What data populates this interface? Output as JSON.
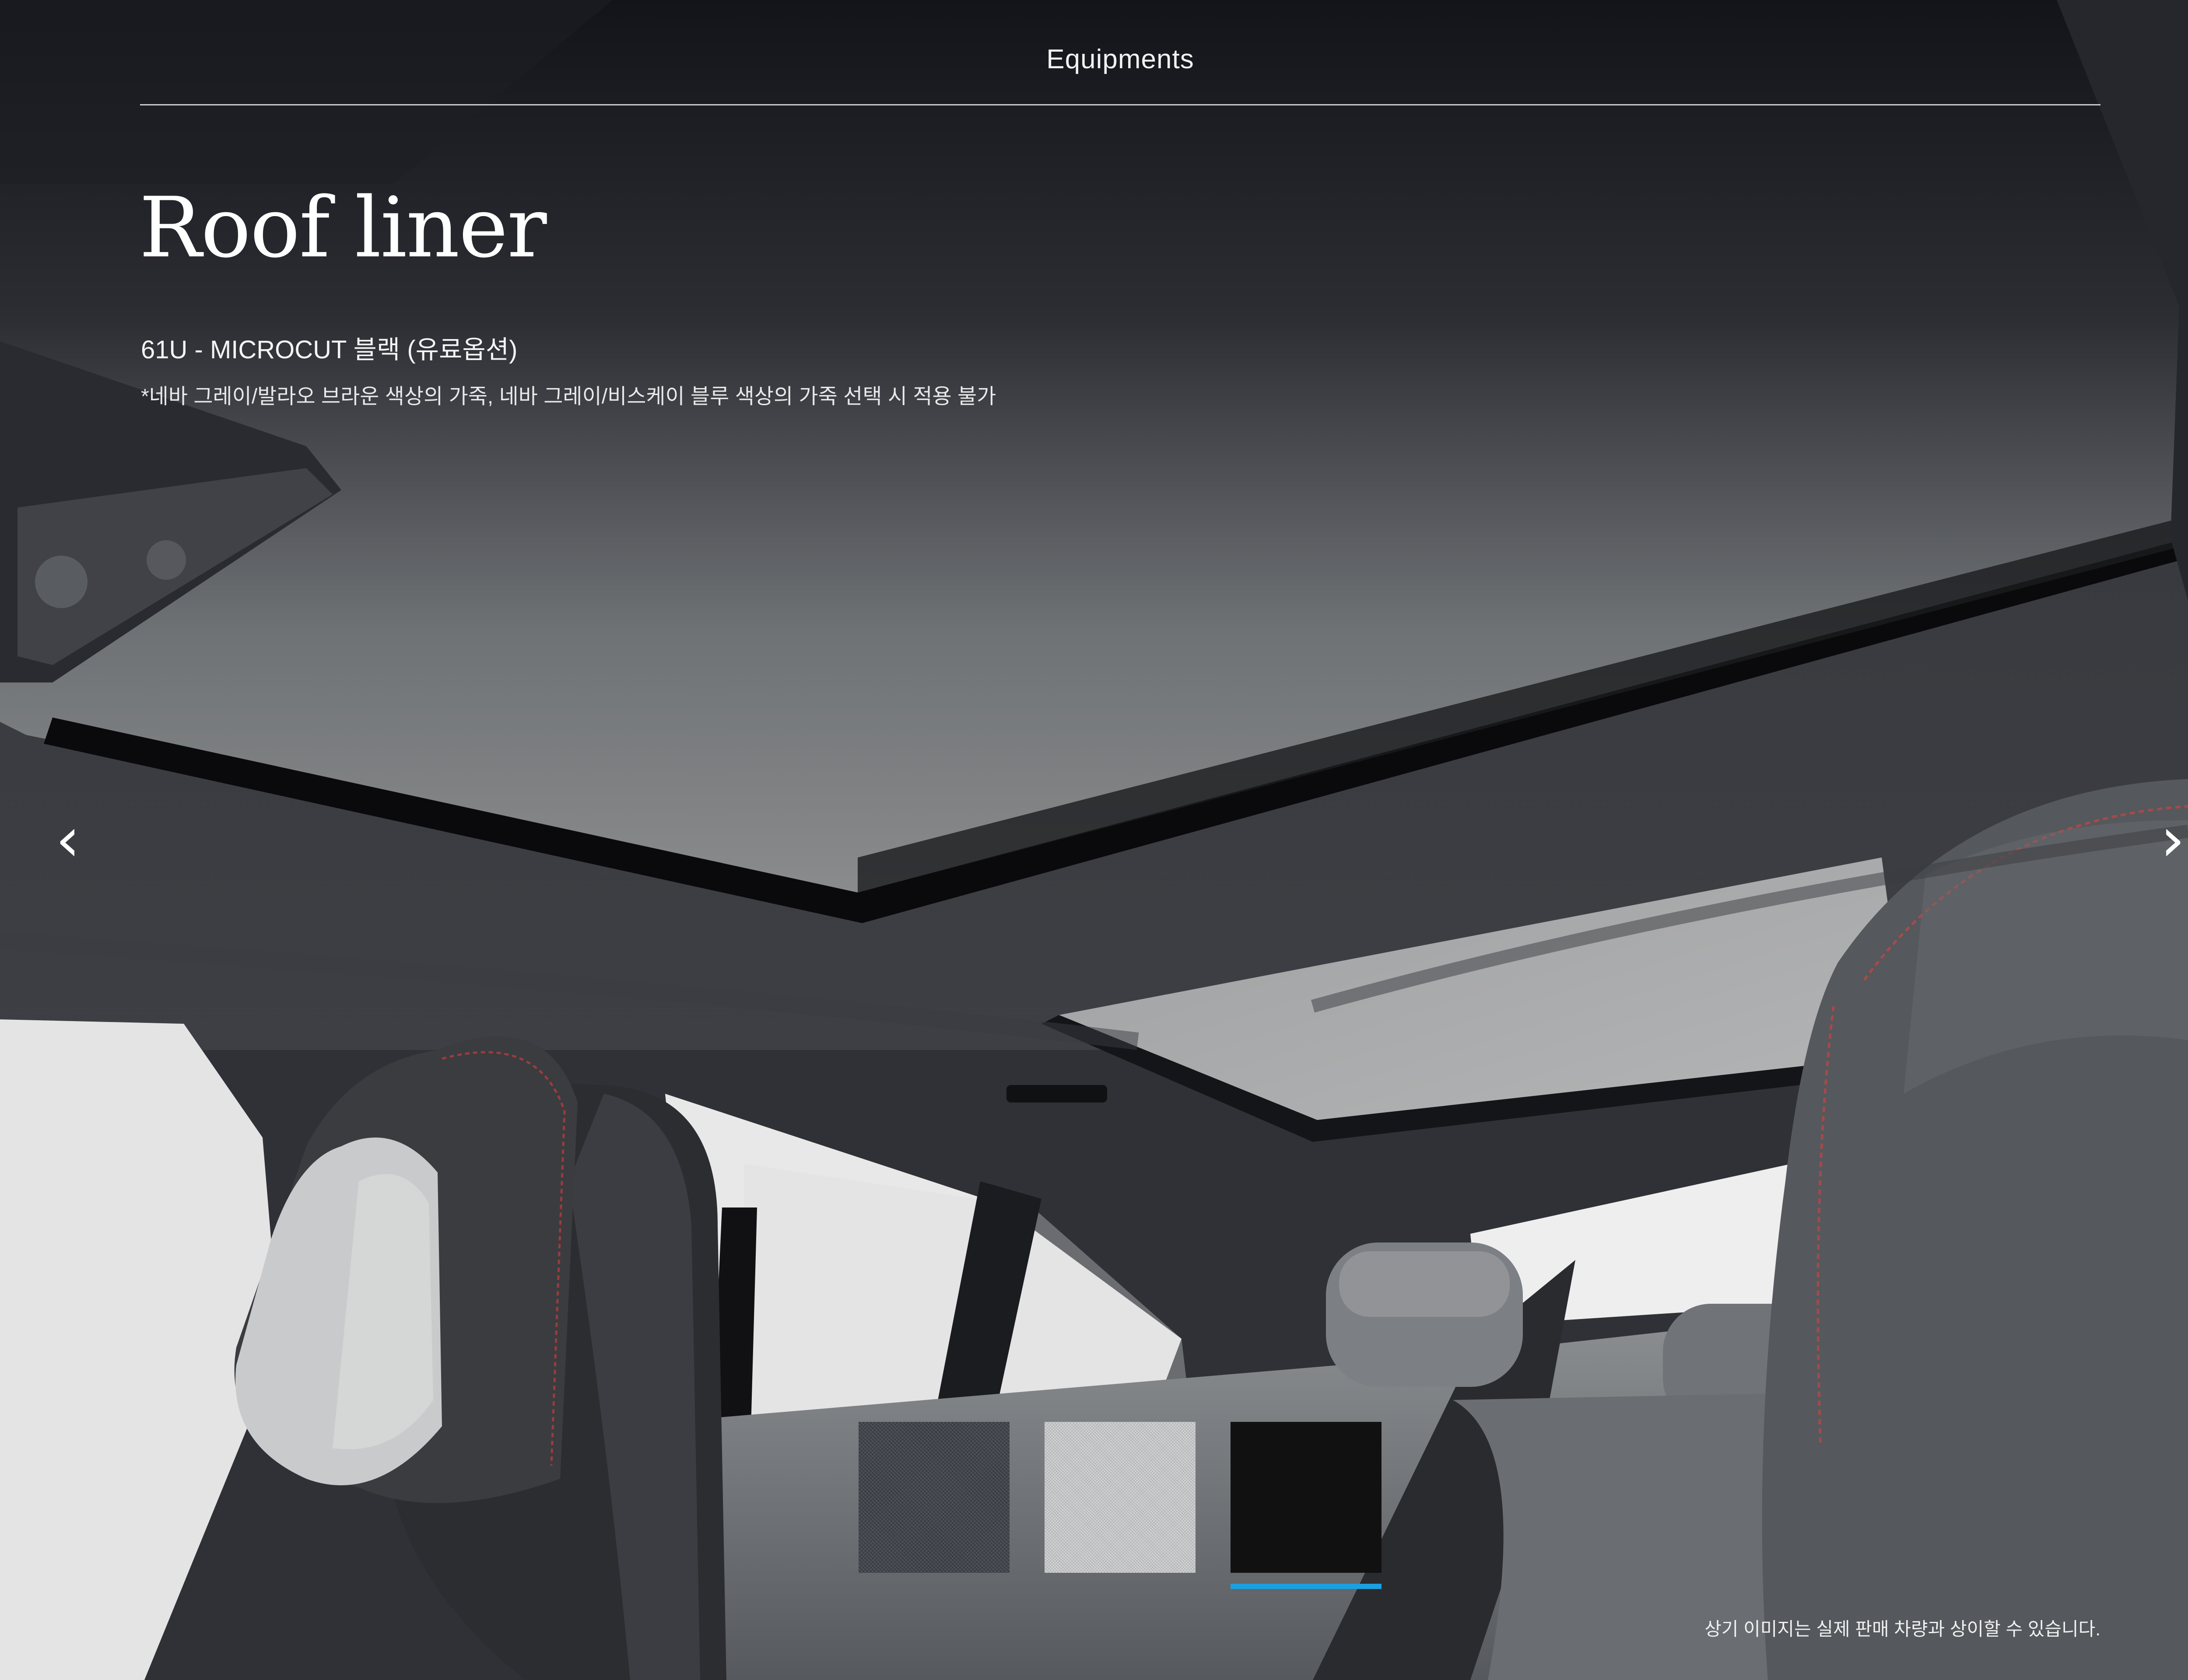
{
  "header": {
    "title": "Equipments"
  },
  "page": {
    "title": "Roof liner"
  },
  "option": {
    "code_label": "61U - MICROCUT 블랙 (유료옵션)",
    "note": "*네바 그레이/발라오 브라운 색상의 가죽, 네바 그레이/비스케이 블루 색상의 가죽 선택 시 적용 불가"
  },
  "nav": {
    "prev_icon": "chevron-left-icon",
    "prev_glyph": "‹",
    "next_icon": "chevron-right-icon",
    "next_glyph": "›"
  },
  "swatches": [
    {
      "name": "dark-grey-fabric",
      "color": "#3f434a",
      "selected": false
    },
    {
      "name": "light-grey-fabric",
      "color": "#c9cbcc",
      "selected": false
    },
    {
      "name": "black-microcut",
      "color": "#111112",
      "selected": true
    }
  ],
  "colors": {
    "accent": "#1aa0e0",
    "text": "#ffffff"
  },
  "footer": {
    "disclaimer": "상기 이미지는 실제 판매 차량과 상이할 수 있습니다."
  }
}
